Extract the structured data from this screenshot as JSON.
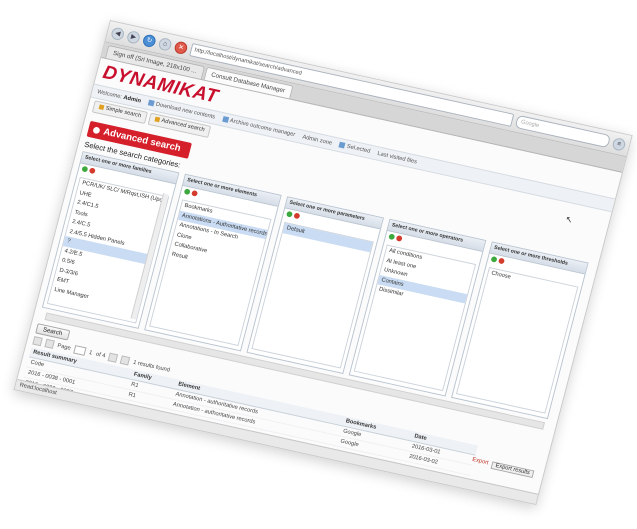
{
  "browser": {
    "url": "http://localhost/dynamikat/search/advanced",
    "search_placeholder": "Google",
    "tabs": [
      {
        "label": "Sign off (Sri Image, 218x100 ...",
        "active": false
      },
      {
        "label": "Consult Database Manager",
        "active": true
      }
    ]
  },
  "app": {
    "brand": "DYNAMIKAT",
    "welcome_prefix": "Welcome",
    "user": "Admin",
    "menu": [
      "Download new contents",
      "Archive outcome manager",
      "Admin zone",
      "Sel.ected",
      "Last visited files"
    ],
    "tabs": [
      "Simple search",
      "Advanced search"
    ]
  },
  "advanced": {
    "title": "Advanced search",
    "select_categories": "Select the search categories:",
    "columns": [
      {
        "header": "Select one or more families",
        "items": [
          "PCR/UK/ SLC/ M/Rqst,ISH (Update)",
          "UHE",
          "2.4/C1.5",
          "Tools",
          "2.4/C.5",
          "2.4/5.5 Hidden Panels",
          "?",
          "4.2/E.5",
          "0.5/6",
          "D-3/3/6",
          "EMT",
          "Line Manager"
        ],
        "selected": 6,
        "scroll": true
      },
      {
        "header": "Select one or more elements",
        "items": [
          "Bookmarks",
          "Annotations - Authoritative records",
          "Annotations - In Search",
          "Clone",
          "Collaborative",
          "Result"
        ],
        "selected": 1,
        "scroll": false
      },
      {
        "header": "Select one or more parameters",
        "items": [
          "Default"
        ],
        "selected": 0,
        "scroll": false
      },
      {
        "header": "Select one or more operators",
        "items": [
          "All conditions",
          "At least one",
          "Unknown",
          "Contains",
          "Dissimilar"
        ],
        "selected": 3,
        "scroll": false
      },
      {
        "header": "Select one or more thresholds",
        "items": [
          "Choose"
        ],
        "selected": -1,
        "scroll": false
      }
    ]
  },
  "results": {
    "search_button": "Search",
    "pager": {
      "prefix": "Page",
      "page": "1",
      "suffix": "of 4",
      "count": "1 results found"
    },
    "columns": [
      "Result summary",
      "Family",
      "Element",
      "Bookmarks",
      "Date"
    ],
    "rows": [
      [
        "Code",
        "R1",
        "Annotation - authoritative records",
        "Google",
        "2016-03-01"
      ],
      [
        "2016 - 0038 - 0001",
        "R1",
        "Annotation - authoritative records",
        "Google",
        "2016-03-02"
      ],
      [
        "2016 - 0038 - 0007",
        "",
        "",
        "",
        ""
      ]
    ],
    "export_label": "Export",
    "export_button": "Export results"
  },
  "status": "Read:localhost"
}
